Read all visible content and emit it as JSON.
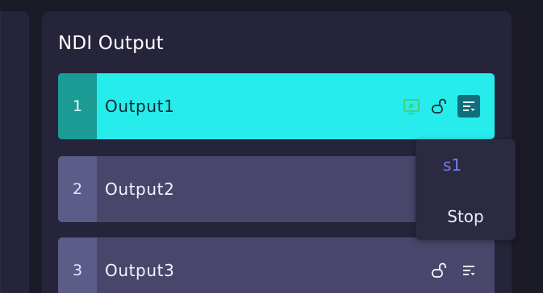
{
  "panel": {
    "title": "NDI Output"
  },
  "outputs": [
    {
      "index": "1",
      "name": "Output1",
      "active": true
    },
    {
      "index": "2",
      "name": "Output2",
      "active": false
    },
    {
      "index": "3",
      "name": "Output3",
      "active": false
    }
  ],
  "dropdown": {
    "items": [
      "s1",
      "Stop"
    ]
  },
  "colors": {
    "background": "#1b1a27",
    "panel": "#25243a",
    "active_row": "#27ecec",
    "row": "#48476b",
    "dropdown_highlight": "#6e7df0"
  },
  "icons": {
    "share": "share-screen-icon",
    "lock": "unlock-icon",
    "menu": "list-menu-icon"
  }
}
